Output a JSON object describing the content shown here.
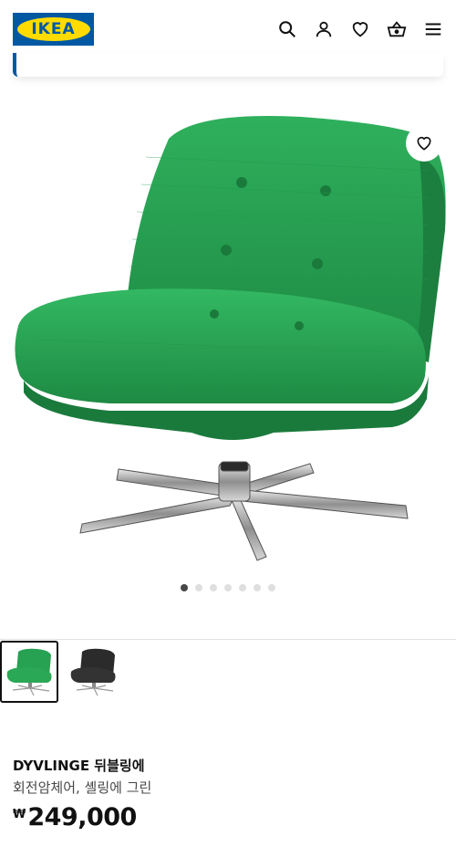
{
  "header": {
    "logo_text": "IKEA",
    "icons": [
      "search-icon",
      "user-icon",
      "heart-icon",
      "shopping-basket-icon",
      "menu-icon"
    ]
  },
  "gallery": {
    "slide_count": 7,
    "active_slide": 1,
    "thumbnails": [
      {
        "color": "green",
        "selected": true
      },
      {
        "color": "black",
        "selected": false
      }
    ]
  },
  "product": {
    "name": "DYVLINGE 뒤블링에",
    "description": "회전암체어, 셸링에 그린",
    "currency": "₩",
    "price": "249,000"
  },
  "colors": {
    "brand_blue": "#0058a3",
    "brand_yellow": "#ffdb00",
    "chair_green": "#27a152",
    "dot_active": "#484848",
    "dot_inactive": "#dfdfdf"
  }
}
